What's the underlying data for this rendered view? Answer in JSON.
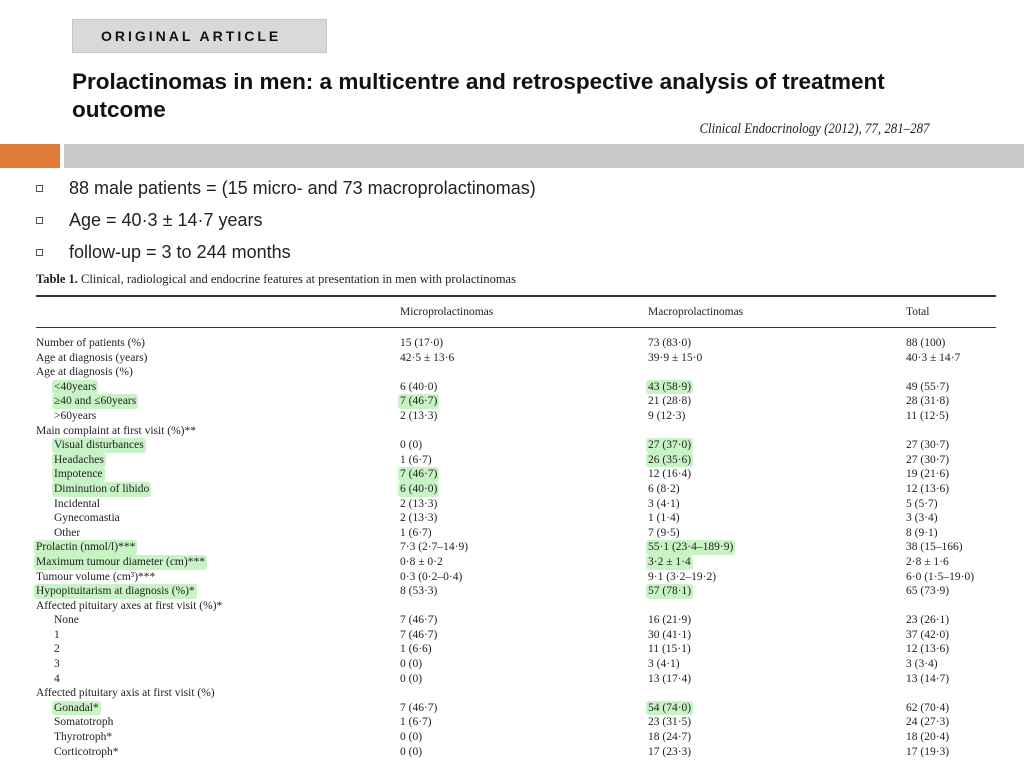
{
  "header": {
    "banner": "ORIGINAL ARTICLE",
    "title": "Prolactinomas in men: a multicentre and retrospective analysis of treatment outcome",
    "journal": "Clinical Endocrinology (2012), 77, 281–287"
  },
  "bullets": [
    "88 male patients  = (15 micro- and 73 macroprolactinomas)",
    "Age = 40·3 ± 14·7 years",
    "follow-up  = 3 to 244 months"
  ],
  "table": {
    "caption_label": "Table 1.",
    "caption_text": "Clinical, radiological and endocrine features at presentation in men with prolactinomas",
    "columns": [
      "Microprolactinomas",
      "Macroprolactinomas",
      "Total"
    ],
    "rows": [
      {
        "label": "Number of patients (%)",
        "indent": false,
        "micro": "15 (17·0)",
        "macro": "73 (83·0)",
        "total": "88 (100)"
      },
      {
        "label": "Age at diagnosis (years)",
        "indent": false,
        "micro": "42·5 ± 13·6",
        "macro": "39·9 ± 15·0",
        "total": "40·3 ± 14·7"
      },
      {
        "label": "Age at diagnosis (%)",
        "indent": false,
        "micro": "",
        "macro": "",
        "total": ""
      },
      {
        "label": "<40years",
        "indent": true,
        "hl_label": true,
        "micro": "6 (40·0)",
        "macro": "43 (58·9)",
        "hl_macro": true,
        "total": "49 (55·7)"
      },
      {
        "label": "≥40 and  ≤60years",
        "indent": true,
        "hl_label": true,
        "micro": "7 (46·7)",
        "hl_micro": true,
        "macro": "21 (28·8)",
        "total": "28 (31·8)"
      },
      {
        "label": ">60years",
        "indent": true,
        "micro": "2 (13·3)",
        "macro": "9 (12·3)",
        "total": "11 (12·5)"
      },
      {
        "label": "Main complaint at first visit (%)**",
        "indent": false,
        "micro": "",
        "macro": "",
        "total": ""
      },
      {
        "label": "Visual disturbances",
        "indent": true,
        "hl_label": true,
        "micro": "0 (0)",
        "macro": "27 (37·0)",
        "hl_macro": true,
        "total": "27 (30·7)"
      },
      {
        "label": "Headaches",
        "indent": true,
        "hl_label": true,
        "micro": "1 (6·7)",
        "macro": "26 (35·6)",
        "hl_macro": true,
        "total": "27 (30·7)"
      },
      {
        "label": "Impotence",
        "indent": true,
        "hl_label": true,
        "micro": "7 (46·7)",
        "hl_micro": true,
        "macro": "12 (16·4)",
        "total": "19 (21·6)"
      },
      {
        "label": "Diminution of libido",
        "indent": true,
        "hl_label": true,
        "micro": "6 (40·0)",
        "hl_micro": true,
        "macro": "6 (8·2)",
        "total": "12 (13·6)"
      },
      {
        "label": "Incidental",
        "indent": true,
        "micro": "2 (13·3)",
        "macro": "3 (4·1)",
        "total": "5 (5·7)"
      },
      {
        "label": "Gynecomastia",
        "indent": true,
        "micro": "2 (13·3)",
        "macro": "1 (1·4)",
        "total": "3 (3·4)"
      },
      {
        "label": "Other",
        "indent": true,
        "micro": "1 (6·7)",
        "macro": "7 (9·5)",
        "total": "8 (9·1)"
      },
      {
        "label": "Prolactin (nmol/l)***",
        "indent": false,
        "hl_label": true,
        "micro": "7·3 (2·7–14·9)",
        "macro": "55·1 (23·4–189·9)",
        "hl_macro": true,
        "total": "38 (15–166)"
      },
      {
        "label": "Maximum tumour diameter (cm)***",
        "indent": false,
        "hl_label": true,
        "micro": "0·8 ± 0·2",
        "macro": "3·2 ± 1·4",
        "hl_macro": true,
        "total": "2·8 ± 1·6"
      },
      {
        "label": "Tumour volume (cm³)***",
        "indent": false,
        "micro": "0·3 (0·2–0·4)",
        "macro": "9·1 (3·2–19·2)",
        "total": "6·0 (1·5–19·0)"
      },
      {
        "label": "Hypopituitarism at diagnosis (%)*",
        "indent": false,
        "hl_label": true,
        "micro": "8 (53·3)",
        "macro": "57 (78·1)",
        "hl_macro": true,
        "total": "65 (73·9)"
      },
      {
        "label": "Affected pituitary axes at first visit (%)*",
        "indent": false,
        "micro": "",
        "macro": "",
        "total": ""
      },
      {
        "label": "None",
        "indent": true,
        "micro": "7 (46·7)",
        "macro": "16 (21·9)",
        "total": "23 (26·1)"
      },
      {
        "label": "1",
        "indent": true,
        "micro": "7 (46·7)",
        "macro": "30 (41·1)",
        "total": "37 (42·0)"
      },
      {
        "label": "2",
        "indent": true,
        "micro": "1 (6·6)",
        "macro": "11 (15·1)",
        "total": "12 (13·6)"
      },
      {
        "label": "3",
        "indent": true,
        "micro": "0 (0)",
        "macro": "3 (4·1)",
        "total": "3 (3·4)"
      },
      {
        "label": "4",
        "indent": true,
        "micro": "0 (0)",
        "macro": "13 (17·4)",
        "total": "13 (14·7)"
      },
      {
        "label": "Affected pituitary axis at first visit (%)",
        "indent": false,
        "micro": "",
        "macro": "",
        "total": ""
      },
      {
        "label": "Gonadal*",
        "indent": true,
        "hl_label": true,
        "micro": "7 (46·7)",
        "macro": "54 (74·0)",
        "hl_macro": true,
        "total": "62 (70·4)"
      },
      {
        "label": "Somatotroph",
        "indent": true,
        "micro": "1 (6·7)",
        "macro": "23 (31·5)",
        "total": "24 (27·3)"
      },
      {
        "label": "Thyrotroph*",
        "indent": true,
        "micro": "0 (0)",
        "macro": "18 (24·7)",
        "total": "18 (20·4)"
      },
      {
        "label": "Corticotroph*",
        "indent": true,
        "micro": "0 (0)",
        "macro": "17 (23·3)",
        "total": "17 (19·3)"
      }
    ]
  }
}
